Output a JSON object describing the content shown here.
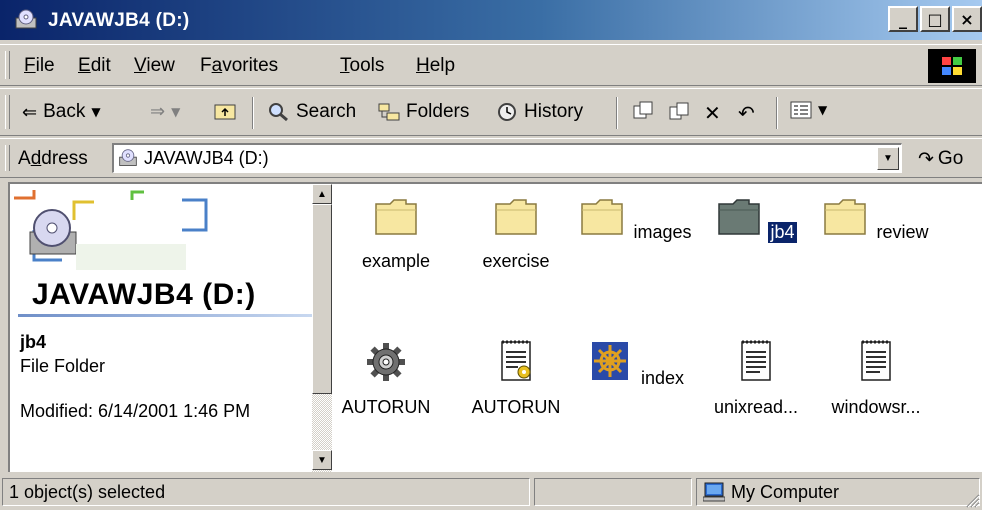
{
  "window": {
    "title": "JAVAWJB4 (D:)",
    "min_glyph": "_",
    "max_glyph": "□",
    "close_glyph": "×"
  },
  "menu": [
    {
      "name": "File",
      "u": "F",
      "rest": "ile"
    },
    {
      "name": "Edit",
      "u": "E",
      "rest": "dit"
    },
    {
      "name": "View",
      "u": "V",
      "rest": "iew"
    },
    {
      "name": "Favorites",
      "pre": "F",
      "u": "a",
      "rest": "vorites"
    },
    {
      "name": "Tools",
      "u": "T",
      "rest": "ools"
    },
    {
      "name": "Help",
      "u": "H",
      "rest": "elp"
    }
  ],
  "toolbar": {
    "back_label": "Back",
    "search_label": "Search",
    "folders_label": "Folders",
    "history_label": "History"
  },
  "address": {
    "label_pre": "A",
    "label_u": "d",
    "label_rest": "dress",
    "value": "JAVAWJB4 (D:)",
    "go_label": "Go"
  },
  "left_pane": {
    "title": "JAVAWJB4 (D:)",
    "selected_name": "jb4",
    "selected_type": "File Folder",
    "modified": "Modified: 6/14/2001 1:46 PM"
  },
  "items": [
    {
      "label": "example",
      "icon": "folder-icon"
    },
    {
      "label": "exercise",
      "icon": "folder-icon"
    },
    {
      "label": "images",
      "icon": "folder-icon"
    },
    {
      "label": "jb4",
      "icon": "folder-icon",
      "selected": true
    },
    {
      "label": "review",
      "icon": "folder-icon"
    },
    {
      "label": "AUTORUN",
      "icon": "gear-icon"
    },
    {
      "label": "AUTORUN",
      "icon": "config-document-icon"
    },
    {
      "label": "index",
      "icon": "ships-wheel-icon"
    },
    {
      "label": "unixread...",
      "icon": "text-document-icon"
    },
    {
      "label": "windowsr...",
      "icon": "text-document-icon"
    }
  ],
  "status": {
    "selection": "1 object(s) selected",
    "zone": "My Computer"
  },
  "colors": {
    "title_gradient_start": "#0a246a",
    "title_gradient_end": "#a6caf0",
    "selection": "#0a246a",
    "folder": "#f7e7a1"
  }
}
